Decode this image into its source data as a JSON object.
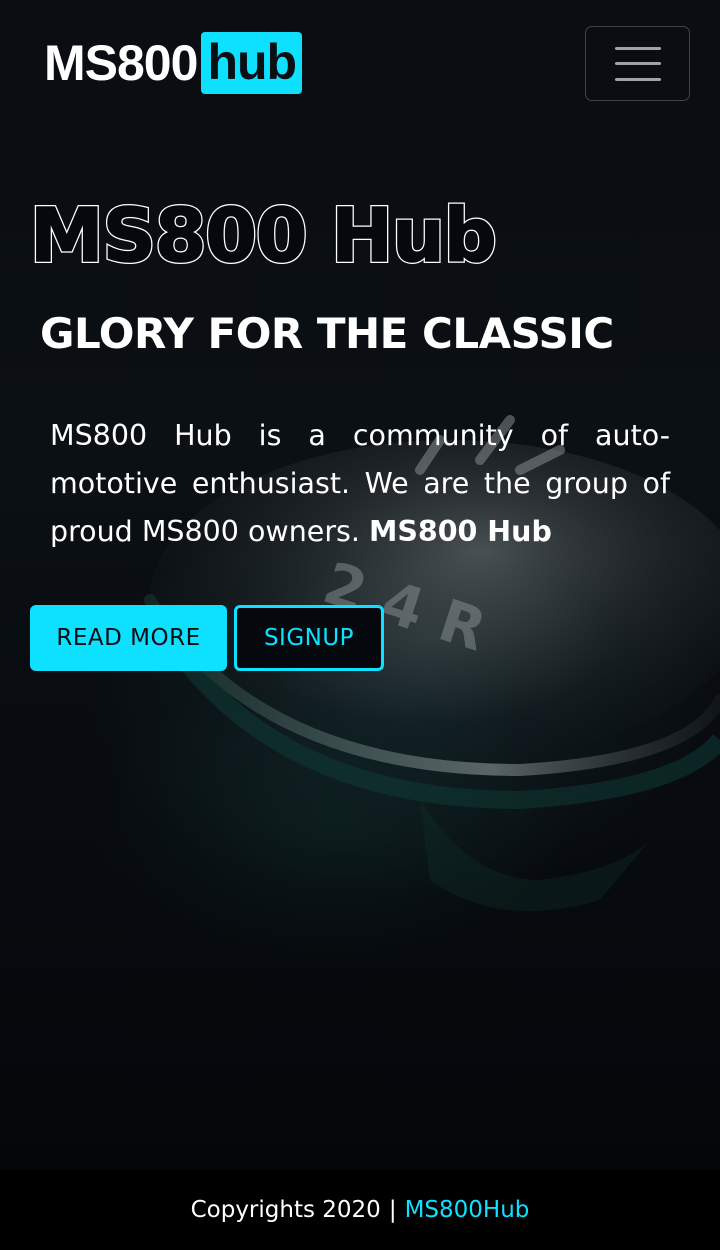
{
  "navbar": {
    "brand_main": "MS800",
    "brand_tag": "hub",
    "menu_icon": "hamburger-menu-icon"
  },
  "hero": {
    "title": "MS800 Hub",
    "subtitle": "GLORY FOR THE CLASSIC",
    "intro_text": "MS800 Hub is a community of auto-mototive enthusiast. We are the group of proud MS800 owners. ",
    "intro_bold": "MS800 Hub",
    "background_image_text": "2 4 R",
    "read_more_label": "READ MORE",
    "signup_label": "SIGNUP"
  },
  "footer": {
    "copyright": "Copyrights 2020",
    "separator": "|",
    "brand_link": "MS800Hub"
  },
  "colors": {
    "accent": "#0ee0ff",
    "background": "#05080c",
    "footer_bg": "#000000",
    "text": "#ffffff"
  }
}
